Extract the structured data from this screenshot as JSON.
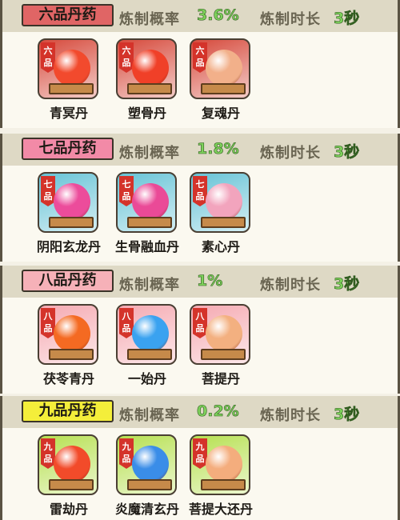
{
  "labels": {
    "rate": "炼制概率",
    "duration": "炼制时长"
  },
  "sections": [
    {
      "title": "六品丹药",
      "tag_color": "#e06565",
      "rate": "3.6%",
      "duration": "3秒",
      "grade_char": "六品",
      "icon_bg": "#d64a3c",
      "items": [
        {
          "name": "青冥丹",
          "orb_color": "#f24a2d"
        },
        {
          "name": "塑骨丹",
          "orb_color": "#f04028"
        },
        {
          "name": "复魂丹",
          "orb_color": "#f2b08a"
        }
      ]
    },
    {
      "title": "七品丹药",
      "tag_color": "#f28aa7",
      "rate": "1.8%",
      "duration": "3秒",
      "grade_char": "七品",
      "icon_bg": "#66c3d6",
      "items": [
        {
          "name": "阴阳玄龙丹",
          "orb_color": "#ec4c9b"
        },
        {
          "name": "生骨融血丹",
          "orb_color": "#ea4a97"
        },
        {
          "name": "素心丹",
          "orb_color": "#f2a4bd"
        }
      ]
    },
    {
      "title": "八品丹药",
      "tag_color": "#f6b1b8",
      "rate": "1%",
      "duration": "3秒",
      "grade_char": "八品",
      "icon_bg": "#f5a9b1",
      "items": [
        {
          "name": "茯苓青丹",
          "orb_color": "#f46a22"
        },
        {
          "name": "一始丹",
          "orb_color": "#3aa2f0"
        },
        {
          "name": "菩提丹",
          "orb_color": "#f3b080"
        }
      ]
    },
    {
      "title": "九品丹药",
      "tag_color": "#f4ee3a",
      "rate": "0.2%",
      "duration": "3秒",
      "grade_char": "九品",
      "icon_bg": "#b6e050",
      "items": [
        {
          "name": "雷劫丹",
          "orb_color": "#f24b2a"
        },
        {
          "name": "炎魔清玄丹",
          "orb_color": "#3a8de8"
        },
        {
          "name": "菩提大还丹",
          "orb_color": "#f4ad7d"
        }
      ]
    }
  ]
}
